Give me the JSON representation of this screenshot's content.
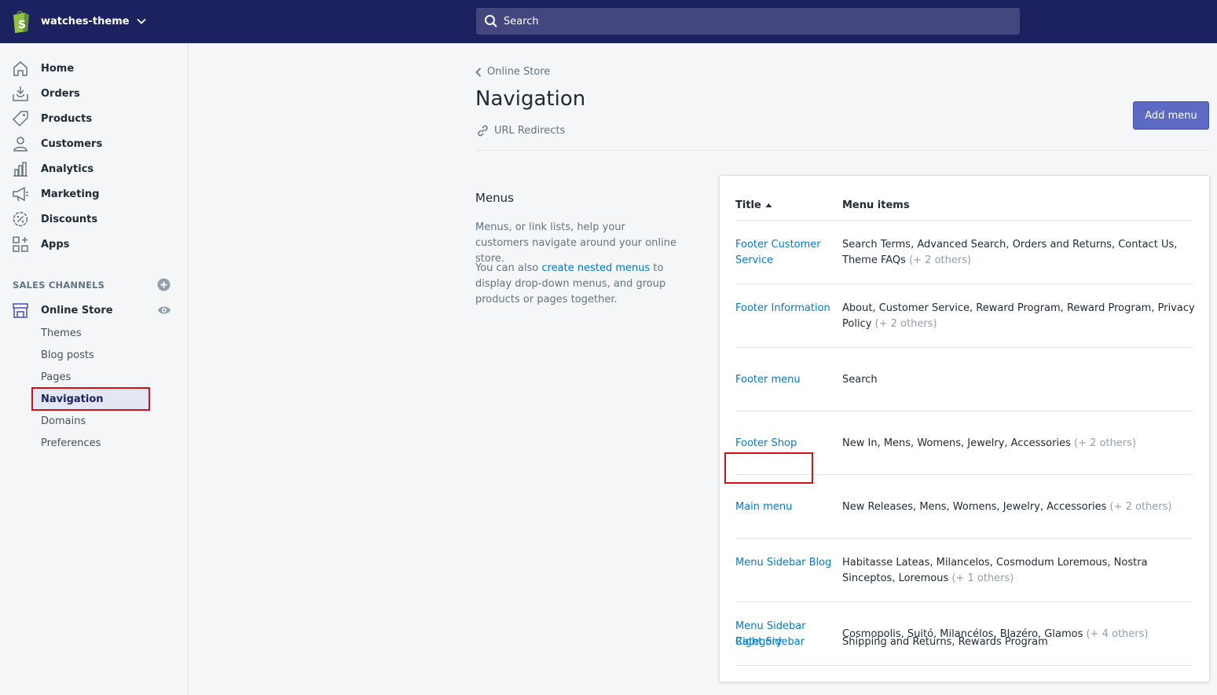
{
  "topbar": {
    "store_name": "watches-theme",
    "search_placeholder": "Search",
    "logo_icon": "shopify-bag-icon"
  },
  "sidebar": {
    "items": [
      {
        "label": "Home",
        "icon": "home-icon"
      },
      {
        "label": "Orders",
        "icon": "orders-icon"
      },
      {
        "label": "Products",
        "icon": "tag-icon"
      },
      {
        "label": "Customers",
        "icon": "person-icon"
      },
      {
        "label": "Analytics",
        "icon": "bar-chart-icon"
      },
      {
        "label": "Marketing",
        "icon": "megaphone-icon"
      },
      {
        "label": "Discounts",
        "icon": "discount-icon"
      },
      {
        "label": "Apps",
        "icon": "apps-icon"
      }
    ],
    "sales_channels_heading": "SALES CHANNELS",
    "online_store_label": "Online Store",
    "sub_items": [
      {
        "label": "Themes"
      },
      {
        "label": "Blog posts"
      },
      {
        "label": "Pages"
      },
      {
        "label": "Navigation",
        "active": true
      },
      {
        "label": "Domains"
      },
      {
        "label": "Preferences"
      }
    ]
  },
  "main": {
    "breadcrumb": "Online Store",
    "title": "Navigation",
    "redirects_label": "URL Redirects",
    "add_menu_label": "Add menu",
    "menus_section": {
      "heading": "Menus",
      "description": "Menus, or link lists, help your customers navigate around your online store.",
      "nested_prefix": "You can also ",
      "nested_link": "create nested menus",
      "nested_suffix": " to display drop-down menus, and group products or pages together."
    },
    "table": {
      "col_title": "Title",
      "col_items": "Menu items",
      "rows": [
        {
          "title": "Footer Customer Service",
          "items": "Search Terms, Advanced Search, Orders and Returns, Contact Us, Theme FAQs",
          "others": "(+ 2 others)"
        },
        {
          "title": "Footer Information",
          "items": "About, Customer Service, Reward Program, Reward Program, Privacy Policy",
          "others": "(+ 2 others)"
        },
        {
          "title": "Footer menu",
          "items": "Search",
          "others": ""
        },
        {
          "title": "Footer Shop",
          "items": "New In, Mens, Womens, Jewelry, Accessories",
          "others": "(+ 2 others)"
        },
        {
          "title": "Main menu",
          "items": "New Releases, Mens, Womens, Jewelry, Accessories",
          "others": "(+ 2 others)"
        },
        {
          "title": "Menu Sidebar Blog",
          "items": "Habitasse Lateas, Milancelos, Cosmodum Loremous, Nostra Sinceptos, Loremous",
          "others": "(+ 1 others)"
        },
        {
          "title": "Menu Sidebar Category",
          "items": "Cosmopolis, Suitó, Milancélos, Blazéro, Glamos",
          "others": "(+ 4 others)"
        },
        {
          "title": "Right Sidebar",
          "items": "Shipping and Returns, Rewards Program",
          "others": ""
        }
      ]
    }
  },
  "colors": {
    "topbar": "#1c2260",
    "search": "#43467f",
    "primary_button": "#5c6ac4",
    "link": "#007ace",
    "highlight_box": "#d40f16"
  }
}
